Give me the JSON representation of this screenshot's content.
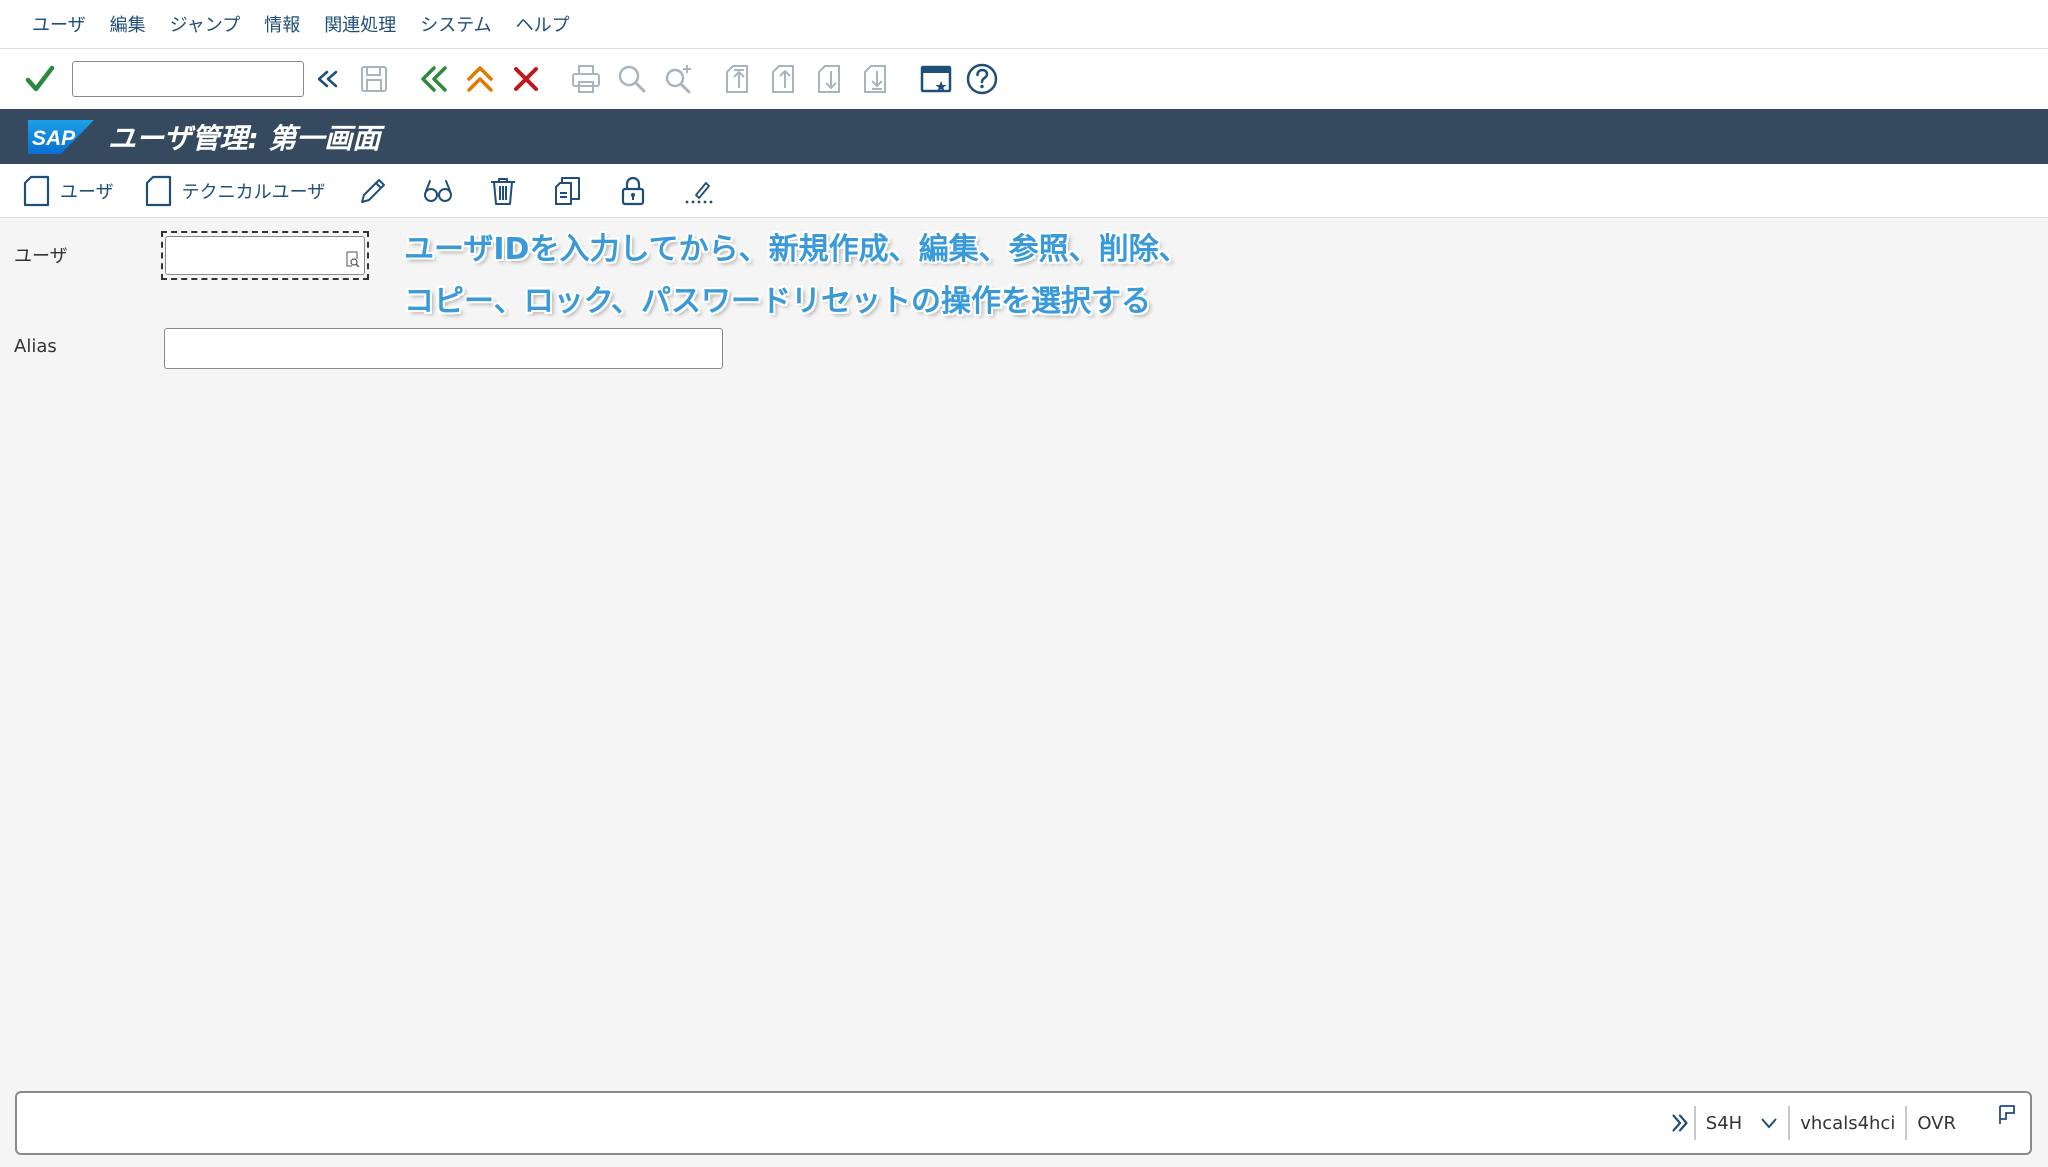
{
  "menu": {
    "items": [
      "ユーザ",
      "編集",
      "ジャンプ",
      "情報",
      "関連処理",
      "システム",
      "ヘルプ"
    ]
  },
  "toolbar": {
    "command_field_value": "",
    "icons": [
      "check-icon",
      "expand-history-icon",
      "save-icon",
      "back-icon",
      "exit-icon",
      "cancel-icon",
      "print-icon",
      "find-icon",
      "find-next-icon",
      "first-page-icon",
      "previous-page-icon",
      "next-page-icon",
      "last-page-icon",
      "new-window-icon",
      "help-icon"
    ]
  },
  "title": {
    "logo_text": "SAP",
    "text": "ユーザ管理: 第一画面"
  },
  "app_toolbar": {
    "create_user_label": "ユーザ",
    "create_technical_user_label": "テクニカルユーザ",
    "icons": [
      "document-icon",
      "document-icon",
      "pencil-icon",
      "glasses-icon",
      "trash-icon",
      "copy-icon",
      "lock-icon",
      "password-reset-icon"
    ]
  },
  "form": {
    "user_label": "ユーザ",
    "user_value": "",
    "alias_label": "Alias",
    "alias_value": ""
  },
  "annotation": {
    "line1": "ユーザIDを入力してから、新規作成、編集、参照、削除、",
    "line2": "コピー、ロック、パスワードリセットの操作を選択する"
  },
  "statusbar": {
    "system": "S4H",
    "server": "vhcals4hci",
    "mode": "OVR"
  },
  "colors": {
    "title_bar": "#354a5f",
    "menu_text": "#1f4e79",
    "annotation": "#3a9ad9",
    "check_green": "#2b8a3e",
    "exit_orange": "#e07b00",
    "cancel_red": "#c0161d"
  }
}
